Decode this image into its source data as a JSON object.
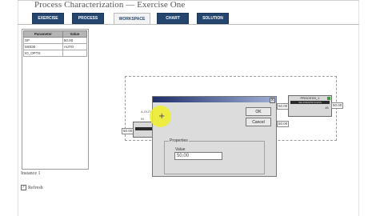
{
  "app": {
    "title": "Process Characterization — Exercise One"
  },
  "tabs": [
    {
      "label": "EXERCISE",
      "active": false
    },
    {
      "label": "PROCESS",
      "active": false
    },
    {
      "label": "WORKSPACE",
      "active": true
    },
    {
      "label": "CHART",
      "active": false
    },
    {
      "label": "SOLUTION",
      "active": false
    }
  ],
  "params": {
    "headers": [
      "Parameter",
      "Value"
    ],
    "rows": [
      [
        "SP",
        "50.00"
      ],
      [
        "MODE",
        "AUTO"
      ],
      [
        "IO_OPTS",
        ""
      ]
    ]
  },
  "instance_label": "Instance 1",
  "refresh": {
    "label": "Refresh",
    "checked": true
  },
  "diagram": {
    "left_value": "50.00",
    "right_value": "50.00",
    "mid_value_a": "50.00",
    "mid_value_b": "50.00",
    "process_block": {
      "name": "PROCESS_1",
      "type": "SELFREGPROCESS",
      "number": "#1"
    },
    "ghost_labels": [
      "A-OUT",
      "IN",
      "OUT"
    ]
  },
  "dialog": {
    "close_glyph": "×",
    "ok_label": "OK",
    "cancel_label": "Cancel",
    "group_label": "Properties",
    "field_label": "Value",
    "field_value": "50.00"
  },
  "colors": {
    "tab_bg": "#23456e",
    "dialog_title_start": "#1e2f6a",
    "cursor_highlight": "#eeee28"
  }
}
